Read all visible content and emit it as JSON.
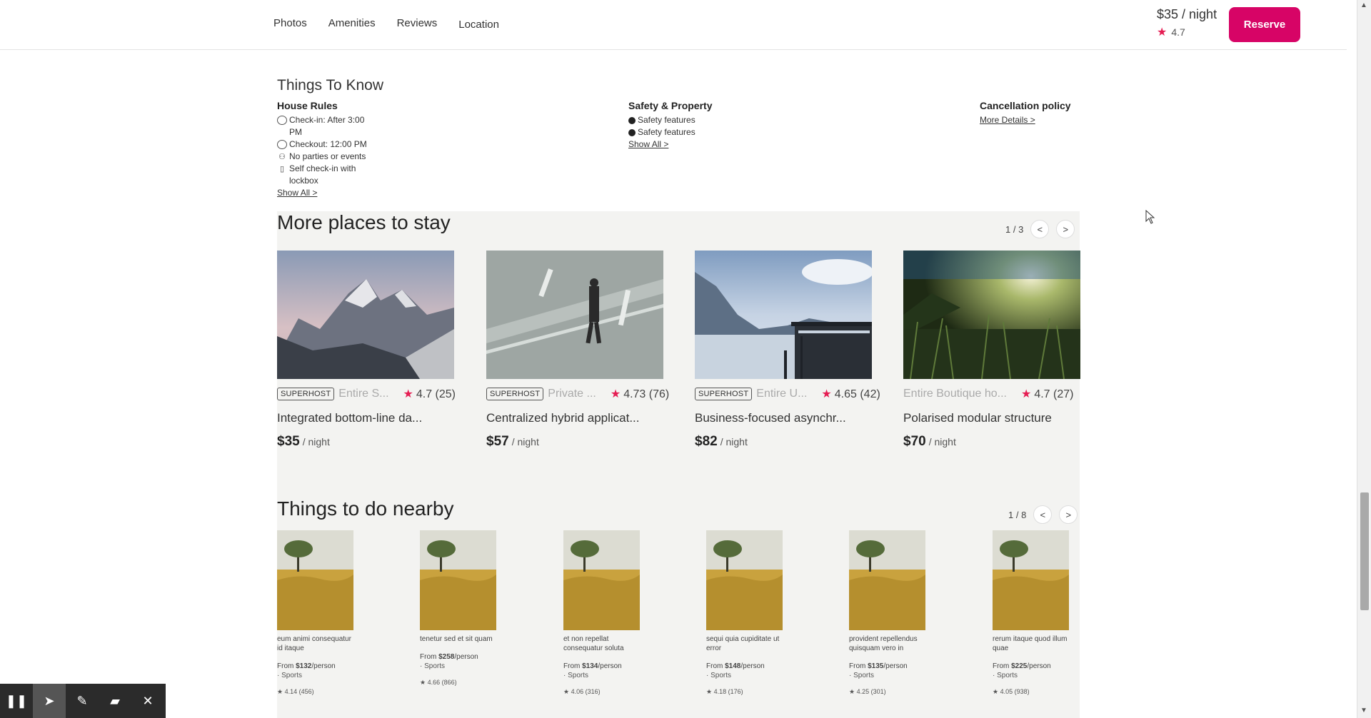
{
  "nav": {
    "links": [
      "Photos",
      "Amenities",
      "Reviews",
      "Location"
    ],
    "price": "$35 / night",
    "rating": "4.7",
    "reserve_label": "Reserve",
    "accent": "#d70466"
  },
  "things_to_know": {
    "title": "Things To Know",
    "house_rules": {
      "heading": "House Rules",
      "items": [
        "Check-in: After 3:00 PM",
        "Checkout: 12:00 PM",
        "No parties or events",
        "Self check-in with lockbox"
      ],
      "show_all": "Show All >"
    },
    "safety": {
      "heading": "Safety & Property",
      "items": [
        "Safety features",
        "Safety features"
      ],
      "show_all": "Show All >"
    },
    "cancellation": {
      "heading": "Cancellation policy",
      "link": "More Details >"
    }
  },
  "places": {
    "title": "More places to stay",
    "pager": "1 / 3",
    "prev": "<",
    "next": ">",
    "cards": [
      {
        "badge": "SUPERHOST",
        "type": "Entire S...",
        "rating": "4.7 (25)",
        "name": "Integrated bottom-line da...",
        "price": "$35",
        "unit": "/ night",
        "image": "mountain"
      },
      {
        "badge": "SUPERHOST",
        "type": "Private ...",
        "rating": "4.73 (76)",
        "name": "Centralized hybrid applicat...",
        "price": "$57",
        "unit": "/ night",
        "image": "man-walking"
      },
      {
        "badge": "SUPERHOST",
        "type": "Entire U...",
        "rating": "4.65 (42)",
        "name": "Business-focused asynchr...",
        "price": "$82",
        "unit": "/ night",
        "image": "lake-pier"
      },
      {
        "badge": "",
        "type": "Entire Boutique ho...",
        "rating": "4.7 (27)",
        "name": "Polarised modular structure",
        "price": "$70",
        "unit": "/ night",
        "image": "grass-sun"
      }
    ]
  },
  "activities": {
    "title": "Things to do nearby",
    "pager": "1 / 8",
    "prev": "<",
    "next": ">",
    "items": [
      {
        "name": "eum animi consequatur id itaque",
        "from": "From ",
        "price": "$132",
        "per": "/person",
        "category": "· Sports",
        "rating": "4.14 (456)"
      },
      {
        "name": "tenetur sed et sit quam",
        "from": "From ",
        "price": "$258",
        "per": "/person",
        "category": "· Sports",
        "rating": "4.66 (866)"
      },
      {
        "name": "et non repellat consequatur soluta",
        "from": "From ",
        "price": "$134",
        "per": "/person",
        "category": "· Sports",
        "rating": "4.06 (316)"
      },
      {
        "name": "sequi quia cupiditate ut error",
        "from": "From ",
        "price": "$148",
        "per": "/person",
        "category": "· Sports",
        "rating": "4.18 (176)"
      },
      {
        "name": "provident repellendus quisquam vero in",
        "from": "From ",
        "price": "$135",
        "per": "/person",
        "category": "· Sports",
        "rating": "4.25 (301)"
      },
      {
        "name": "rerum itaque quod illum quae",
        "from": "From ",
        "price": "$225",
        "per": "/person",
        "category": "· Sports",
        "rating": "4.05 (938)"
      }
    ]
  },
  "toolbar": {
    "icons": [
      "pause-icon",
      "pointer-icon",
      "pen-icon",
      "highlighter-icon",
      "close-icon"
    ]
  }
}
